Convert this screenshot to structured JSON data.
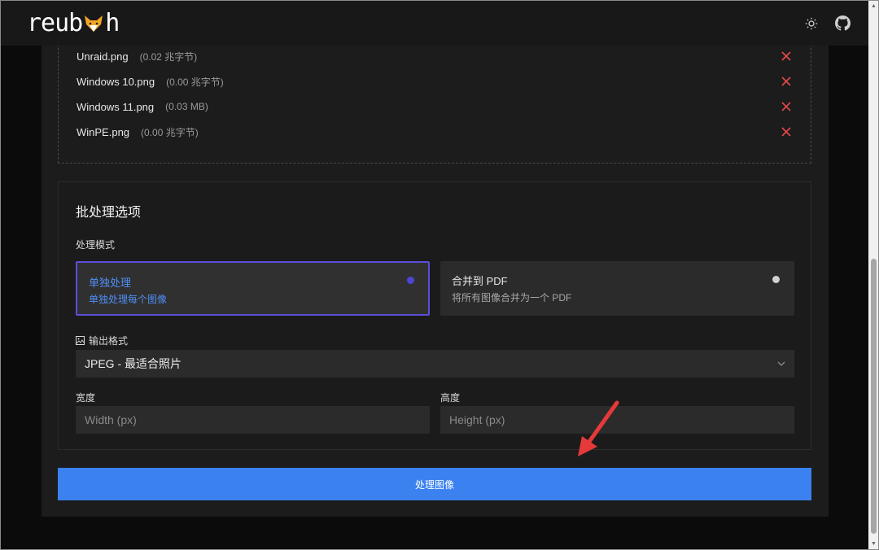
{
  "header": {
    "logo_text_left": "reub",
    "logo_text_right": "h",
    "theme_icon": "sun-icon",
    "github_icon": "github-icon"
  },
  "files": [
    {
      "name": "Unraid.png",
      "size": "(0.02 兆字节)"
    },
    {
      "name": "Windows 10.png",
      "size": "(0.00 兆字节)"
    },
    {
      "name": "Windows 11.png",
      "size": "(0.03 MB)"
    },
    {
      "name": "WinPE.png",
      "size": "(0.00 兆字节)"
    }
  ],
  "options": {
    "title": "批处理选项",
    "mode_label": "处理模式",
    "modes": [
      {
        "title": "单独处理",
        "desc": "单独处理每个图像",
        "selected": true
      },
      {
        "title": "合并到 PDF",
        "desc": "将所有图像合并为一个 PDF",
        "selected": false
      }
    ],
    "format_label": "输出格式",
    "format_value": "JPEG - 最适合照片",
    "width_label": "宽度",
    "width_placeholder": "Width (px)",
    "height_label": "高度",
    "height_placeholder": "Height (px)"
  },
  "process_button": "处理图像",
  "colors": {
    "accent": "#3b82f0",
    "selected_border": "#5b4fd9",
    "remove": "#e5484d",
    "annotation": "#e5393a"
  }
}
